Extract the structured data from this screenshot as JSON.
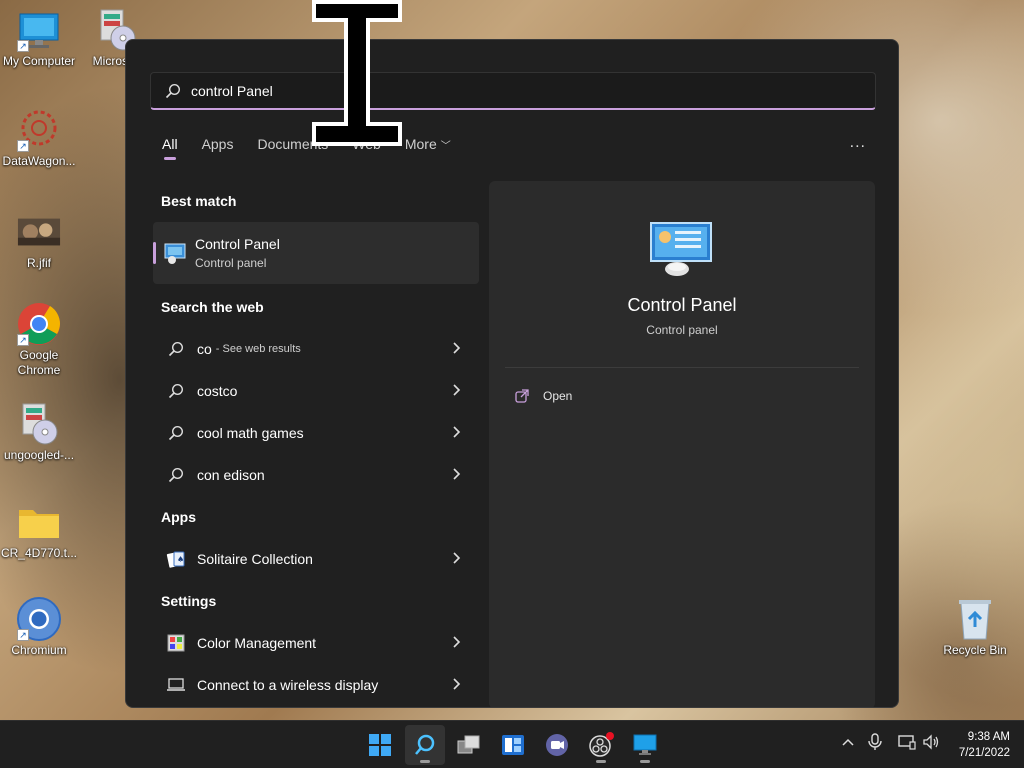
{
  "desktop": {
    "icons": [
      {
        "label": "My Computer",
        "icon": "monitor-icon"
      },
      {
        "label": "Microsoft",
        "icon": "installer-cd-icon"
      },
      {
        "label": "DataWagon...",
        "icon": "datawagon-icon"
      },
      {
        "label": "R.jfif",
        "icon": "image-file-icon"
      },
      {
        "label": "Google Chrome",
        "icon": "chrome-icon"
      },
      {
        "label": "ungoogled-...",
        "icon": "installer-cd-icon"
      },
      {
        "label": "CR_4D770.t...",
        "icon": "folder-icon"
      },
      {
        "label": "Chromium",
        "icon": "chromium-icon"
      },
      {
        "label": "Recycle Bin",
        "icon": "recycle-bin-icon"
      }
    ]
  },
  "search": {
    "query": "control Panel",
    "tabs": [
      "All",
      "Apps",
      "Documents",
      "Web",
      "More"
    ],
    "active_tab": "All",
    "more_label": "..."
  },
  "results": {
    "best_match_title": "Best match",
    "best_match": {
      "title": "Control Panel",
      "subtitle": "Control panel"
    },
    "web_title": "Search the web",
    "web": [
      {
        "text": "co",
        "suffix": "- See web results"
      },
      {
        "text": "costco"
      },
      {
        "text": "cool math games"
      },
      {
        "text": "con edison"
      }
    ],
    "apps_title": "Apps",
    "apps": [
      {
        "text": "Solitaire Collection"
      }
    ],
    "settings_title": "Settings",
    "settings": [
      {
        "text": "Color Management"
      },
      {
        "text": "Connect to a wireless display"
      }
    ]
  },
  "detail": {
    "title": "Control Panel",
    "subtitle": "Control panel",
    "actions": [
      {
        "label": "Open"
      }
    ]
  },
  "taskbar": {
    "time": "9:38 AM",
    "date": "7/21/2022"
  },
  "colors": {
    "accent": "#c9a0dc",
    "panel_bg": "#202020",
    "preview_bg": "#2b2b2b"
  }
}
